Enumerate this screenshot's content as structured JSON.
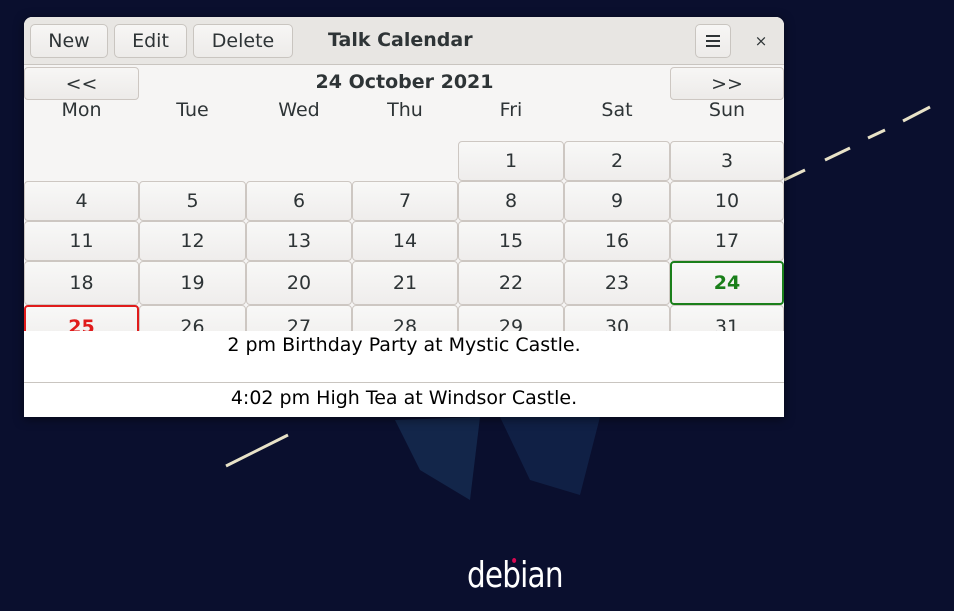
{
  "window": {
    "title": "Talk Calendar",
    "buttons": {
      "new": "New",
      "edit": "Edit",
      "delete": "Delete"
    },
    "close_glyph": "×"
  },
  "calendar": {
    "prev_label": "<<",
    "next_label": ">>",
    "month_label": "24 October 2021",
    "weekdays": [
      "Mon",
      "Tue",
      "Wed",
      "Thu",
      "Fri",
      "Sat",
      "Sun"
    ],
    "first_weekday_index": 4,
    "days_in_month": 31,
    "today": 24,
    "selected": 25,
    "today_color": "#1a7f1a",
    "selected_color": "#e01b1b"
  },
  "events": [
    "2 pm Birthday Party at Mystic Castle.",
    "4:02 pm High Tea at Windsor Castle."
  ],
  "desktop": {
    "brand": "debian",
    "background_color": "#0a0f2e",
    "accent_line_color": "#e8e2c8"
  },
  "icons": {
    "menu": "hamburger-menu-icon",
    "close": "close-icon",
    "brand": "debian-swirl-dot-icon"
  }
}
